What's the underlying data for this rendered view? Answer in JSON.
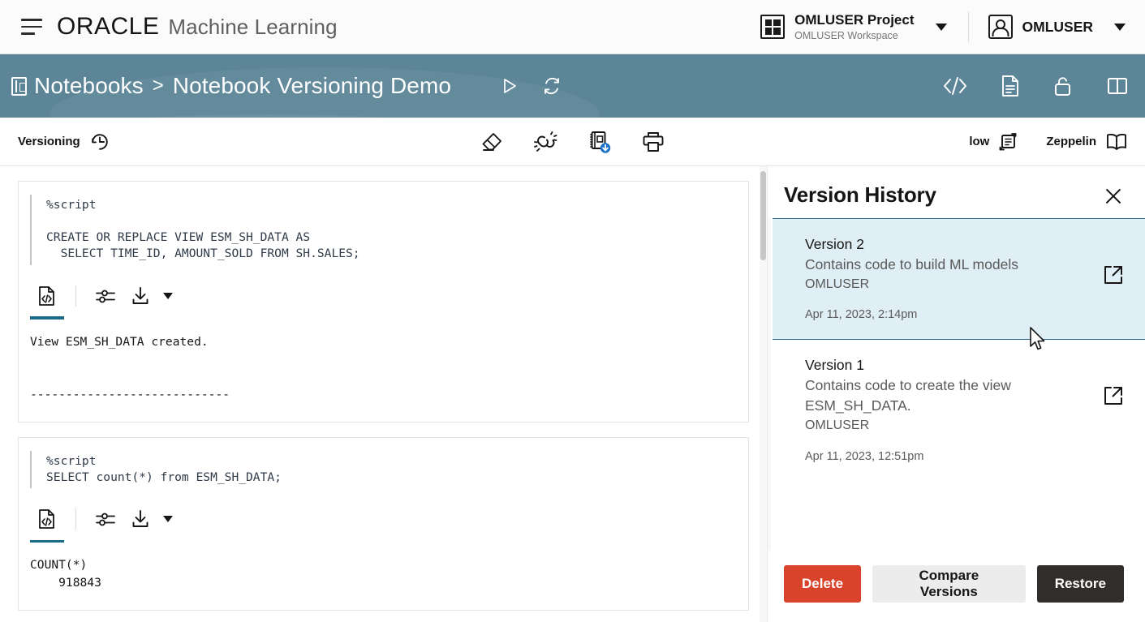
{
  "header": {
    "menu_icon": "hamburger-icon",
    "brand": "ORACLE",
    "product": "Machine Learning",
    "project": {
      "icon": "grid-icon",
      "title": "OMLUSER Project",
      "subtitle": "OMLUSER Workspace",
      "caret": "chevron-down-icon"
    },
    "user": {
      "icon": "user-avatar-icon",
      "name": "OMLUSER",
      "caret": "chevron-down-icon"
    }
  },
  "breadcrumb": {
    "icon": "notebook-icon",
    "root": "Notebooks",
    "separator": ">",
    "current": "Notebook Versioning Demo",
    "actions": [
      {
        "name": "run-all-icon",
        "icon": "play-icon"
      },
      {
        "name": "refresh-icon",
        "icon": "refresh-icon"
      }
    ],
    "right_actions": [
      {
        "name": "code-view-icon",
        "icon": "code-brackets-icon"
      },
      {
        "name": "notebook-document-icon",
        "icon": "document-icon"
      },
      {
        "name": "unlock-icon",
        "icon": "padlock-open-icon"
      },
      {
        "name": "layout-split-icon",
        "icon": "split-panel-icon"
      }
    ],
    "bar_color": "#5c8698"
  },
  "toolbar": {
    "versioning_label": "Versioning",
    "versioning_icon": "clock-history-icon",
    "center_actions": [
      {
        "name": "clear-output-button",
        "icon": "eraser-icon"
      },
      {
        "name": "unlink-button",
        "icon": "broken-link-icon"
      },
      {
        "name": "save-notebook-button",
        "icon": "notebook-download-icon"
      },
      {
        "name": "print-button",
        "icon": "printer-icon"
      }
    ],
    "detail_level_label": "low",
    "detail_level_icon": "flow-toggle-icon",
    "interpreter_label": "Zeppelin",
    "interpreter_icon": "open-book-icon"
  },
  "notebook": {
    "paragraphs": [
      {
        "code": "%script\n\nCREATE OR REPLACE VIEW ESM_SH_DATA AS\n  SELECT TIME_ID, AMOUNT_SOLD FROM SH.SALES;",
        "tools": [
          {
            "name": "paragraph-code-toggle",
            "icon": "code-file-icon",
            "active": true
          },
          {
            "name": "paragraph-settings",
            "icon": "sliders-icon",
            "active": false
          },
          {
            "name": "paragraph-download",
            "icon": "download-icon",
            "active": false
          }
        ],
        "output": "View ESM_SH_DATA created.\n\n\n----------------------------"
      },
      {
        "code": "%script\nSELECT count(*) from ESM_SH_DATA;",
        "tools": [
          {
            "name": "paragraph-code-toggle",
            "icon": "code-file-icon",
            "active": true
          },
          {
            "name": "paragraph-settings",
            "icon": "sliders-icon",
            "active": false
          },
          {
            "name": "paragraph-download",
            "icon": "download-icon",
            "active": false
          }
        ],
        "output": "COUNT(*)\n    918843"
      }
    ]
  },
  "version_history": {
    "title": "Version History",
    "close_icon": "close-icon",
    "items": [
      {
        "name": "Version 2",
        "description": "Contains code to build ML models",
        "owner": "OMLUSER",
        "timestamp": "Apr 11, 2023, 2:14pm",
        "selected": true,
        "open_icon": "external-link-icon"
      },
      {
        "name": "Version 1",
        "description": "Contains code to create the view ESM_SH_DATA.",
        "owner": "OMLUSER",
        "timestamp": "Apr 11, 2023, 12:51pm",
        "selected": false,
        "open_icon": "external-link-icon"
      }
    ],
    "buttons": {
      "delete": "Delete",
      "compare": "Compare Versions",
      "restore": "Restore"
    },
    "colors": {
      "delete": "#d9422b",
      "compare": "#ececec",
      "restore": "#312d2a",
      "selected_row": "#e0eff5",
      "selected_border": "#2d6f8a"
    }
  }
}
